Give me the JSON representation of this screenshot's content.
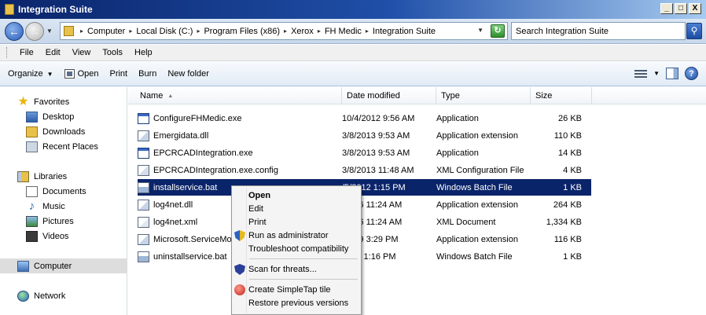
{
  "window": {
    "title": "Integration Suite"
  },
  "window_controls": {
    "minimize": "_",
    "maximize": "□",
    "close": "X"
  },
  "address": {
    "crumbs": [
      "Computer",
      "Local Disk (C:)",
      "Program Files (x86)",
      "Xerox",
      "FH Medic",
      "Integration Suite"
    ]
  },
  "search": {
    "placeholder": "Search Integration Suite"
  },
  "menu": [
    "File",
    "Edit",
    "View",
    "Tools",
    "Help"
  ],
  "toolbar": {
    "organize": "Organize",
    "open": "Open",
    "print": "Print",
    "burn": "Burn",
    "new_folder": "New folder"
  },
  "nav": {
    "favorites": "Favorites",
    "desktop": "Desktop",
    "downloads": "Downloads",
    "recent": "Recent Places",
    "libraries": "Libraries",
    "documents": "Documents",
    "music": "Music",
    "pictures": "Pictures",
    "videos": "Videos",
    "computer": "Computer",
    "network": "Network"
  },
  "columns": {
    "name": "Name",
    "date": "Date modified",
    "type": "Type",
    "size": "Size"
  },
  "files": [
    {
      "name": "ConfigureFHMedic.exe",
      "date": "10/4/2012 9:56 AM",
      "type": "Application",
      "size": "26 KB",
      "icon": "exe-icon"
    },
    {
      "name": "Emergidata.dll",
      "date": "3/8/2013 9:53 AM",
      "type": "Application extension",
      "size": "110 KB",
      "icon": "dll-icon"
    },
    {
      "name": "EPCRCADIntegration.exe",
      "date": "3/8/2013 9:53 AM",
      "type": "Application",
      "size": "14 KB",
      "icon": "exe-icon"
    },
    {
      "name": "EPCRCADIntegration.exe.config",
      "date": "3/8/2013 11:48 AM",
      "type": "XML Configuration File",
      "size": "4 KB",
      "icon": "config-icon"
    },
    {
      "name": "installservice.bat",
      "date": "/5/2012 1:15 PM",
      "type": "Windows Batch File",
      "size": "1 KB",
      "icon": "bat-icon"
    },
    {
      "name": "log4net.dll",
      "date": "/2006 11:24 AM",
      "type": "Application extension",
      "size": "264 KB",
      "icon": "dll-icon"
    },
    {
      "name": "log4net.xml",
      "date": "/2006 11:24 AM",
      "type": "XML Document",
      "size": "1,334 KB",
      "icon": "xml-icon"
    },
    {
      "name": "Microsoft.ServiceMo",
      "date": "/2009 3:29 PM",
      "type": "Application extension",
      "size": "116 KB",
      "icon": "dll-icon"
    },
    {
      "name": "uninstallservice.bat",
      "date": "2012 1:16 PM",
      "type": "Windows Batch File",
      "size": "1 KB",
      "icon": "bat-icon"
    }
  ],
  "context_menu": {
    "open": "Open",
    "edit": "Edit",
    "print": "Print",
    "run_as_admin": "Run as administrator",
    "troubleshoot": "Troubleshoot compatibility",
    "scan": "Scan for threats...",
    "simpletap": "Create SimpleTap tile",
    "restore": "Restore previous versions"
  }
}
